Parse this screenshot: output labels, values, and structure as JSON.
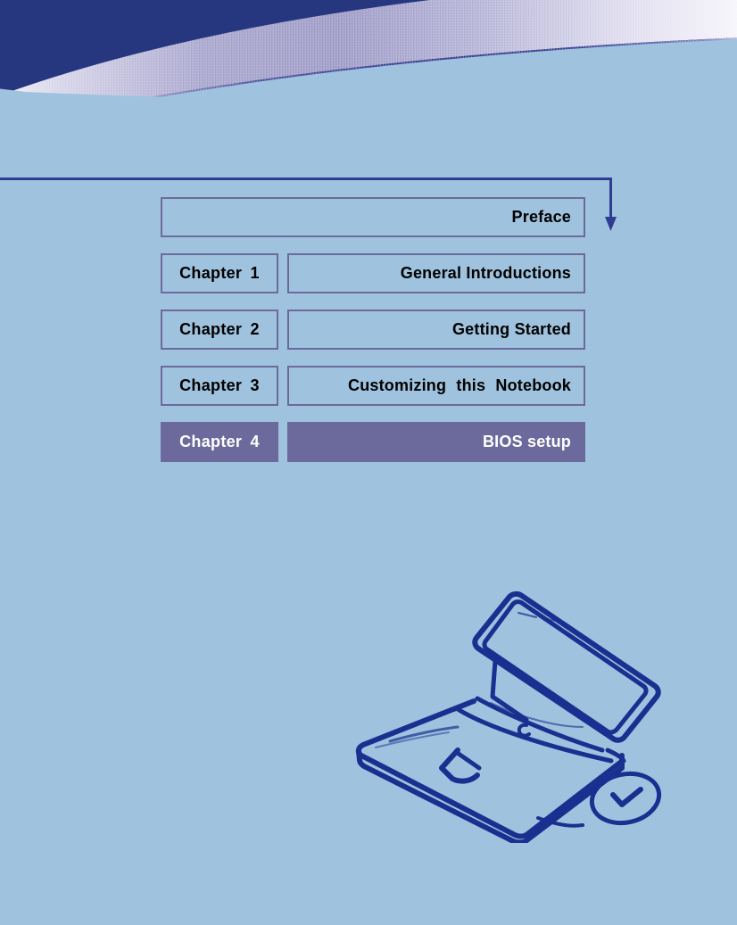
{
  "page": {
    "background_color": "#9fc3de",
    "header_navy_color": "#26367f",
    "accent_line_color": "#2f3c92",
    "box_border_color": "#6c6a9c",
    "highlight_fill_color": "#6c6a9c",
    "sketch_color": "#1a3090"
  },
  "toc": {
    "rows": [
      {
        "chapter": "",
        "title": "Preface",
        "active": false,
        "full": true
      },
      {
        "chapter": "Chapter  1",
        "title": "General Introductions",
        "active": false,
        "full": false
      },
      {
        "chapter": "Chapter  2",
        "title": "Getting Started",
        "active": false,
        "full": false
      },
      {
        "chapter": "Chapter  3",
        "title": "Customizing  this  Notebook",
        "active": false,
        "full": false
      },
      {
        "chapter": "Chapter  4",
        "title": "BIOS setup",
        "active": true,
        "full": false
      }
    ]
  },
  "illustration": {
    "name": "notebook-computer-sketch",
    "parts": [
      "laptop-screen",
      "laptop-base",
      "keyboard",
      "touchpad",
      "mouse"
    ]
  }
}
